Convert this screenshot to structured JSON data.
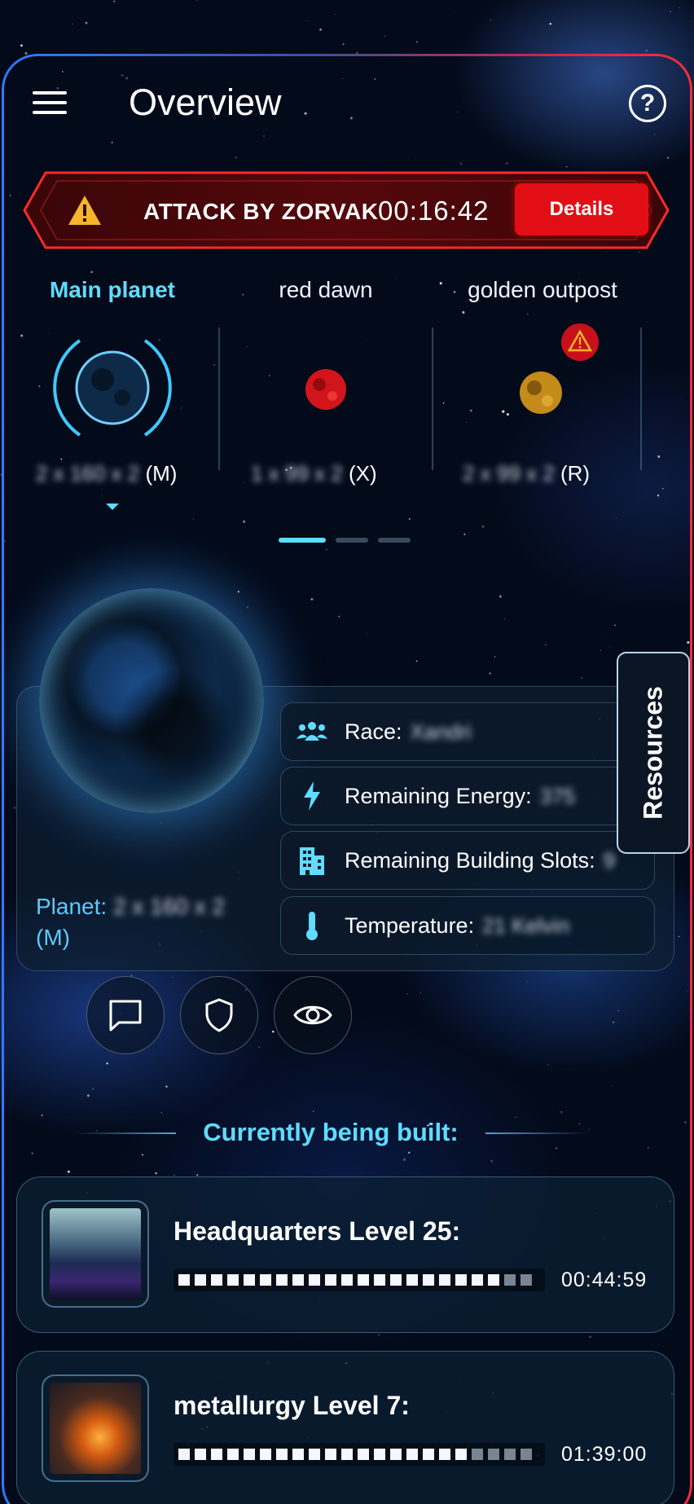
{
  "header": {
    "title": "Overview",
    "help_glyph": "?"
  },
  "attack": {
    "text": "ATTACK BY ZORVAK",
    "timer": "00:16:42",
    "details_label": "Details"
  },
  "planets": [
    {
      "name": "Main planet",
      "coord": "2 x 160 x 2",
      "size": "(M)",
      "active": true
    },
    {
      "name": "red dawn",
      "coord": "1 x 99 x 2",
      "size": "(X)",
      "active": false
    },
    {
      "name": "golden outpost",
      "coord": "2 x 99 x 2",
      "size": "(R)",
      "active": false,
      "alert": true
    }
  ],
  "pager": {
    "count": 3,
    "active_index": 0
  },
  "planet_detail": {
    "label_prefix": "Planet:",
    "coord": "2 x 160 x 2",
    "size": "(M)",
    "rows": [
      {
        "icon": "people-icon",
        "label": "Race:",
        "value": "Xandri"
      },
      {
        "icon": "lightning-icon",
        "label": "Remaining Energy:",
        "value": "375"
      },
      {
        "icon": "building-icon",
        "label": "Remaining Building Slots:",
        "value": "9"
      },
      {
        "icon": "thermometer-icon",
        "label": "Temperature:",
        "value": "21 Kelvin"
      }
    ]
  },
  "resources_tab": {
    "label": "Resources"
  },
  "actions": [
    {
      "icon": "chat-icon"
    },
    {
      "icon": "shield-icon"
    },
    {
      "icon": "eye-icon"
    }
  ],
  "building": {
    "title": "Currently being built:",
    "items": [
      {
        "name": "Headquarters Level 25:",
        "time": "00:44:59",
        "progress": 0.9
      },
      {
        "name": "metallurgy Level 7:",
        "time": "01:39:00",
        "progress": 0.8
      }
    ]
  },
  "colors": {
    "accent": "#5fdcff",
    "danger": "#e10f15"
  }
}
